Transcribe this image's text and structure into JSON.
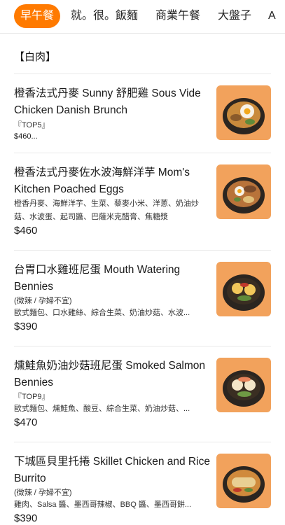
{
  "tabs": [
    "早午餐",
    "就。很。飯麵",
    "商業午餐",
    "大盤子",
    "A"
  ],
  "section_title": "【白肉】",
  "items": [
    {
      "name": "橙香法式丹麥 Sunny 舒肥雞 Sous Vide Chicken Danish Brunch",
      "tag": "『TOP5』",
      "desc": "",
      "price": "$460..."
    },
    {
      "name": "橙香法式丹麥佐水波海鮮洋芋 Mom's Kitchen Poached Eggs",
      "tag": "",
      "desc": "橙香丹麥、海鮮洋芋、生菜、藜麥小米、洋蔥、奶油炒菇、水波蛋、起司醬、巴薩米克醋膏、焦糖漿",
      "price": "$460"
    },
    {
      "name": "台胃口水雞班尼蛋 Mouth Watering Bennies",
      "tag": "(微辣 / 孕婦不宜)",
      "desc": "歐式麵包、口水雞絲、綜合生菜、奶油炒菇、水波...",
      "price": "$390"
    },
    {
      "name": "燻鮭魚奶油炒菇班尼蛋 Smoked Salmon Bennies",
      "tag": "『TOP9』",
      "desc": "歐式麵包、燻鮭魚、酸豆、綜合生菜、奶油炒菇、...",
      "price": "$470"
    },
    {
      "name": "下城區貝里托捲 Skillet Chicken and Rice Burrito",
      "tag": "(微辣 / 孕婦不宜)",
      "desc": "雞肉、Salsa 醬、墨西哥辣椒、BBQ 醬、墨西哥餅...",
      "price": "$390"
    }
  ],
  "colors": {
    "accent": "#ff7a00",
    "thumb_bg": "#f2a25c"
  },
  "icons": [
    "food-photo-icon"
  ]
}
